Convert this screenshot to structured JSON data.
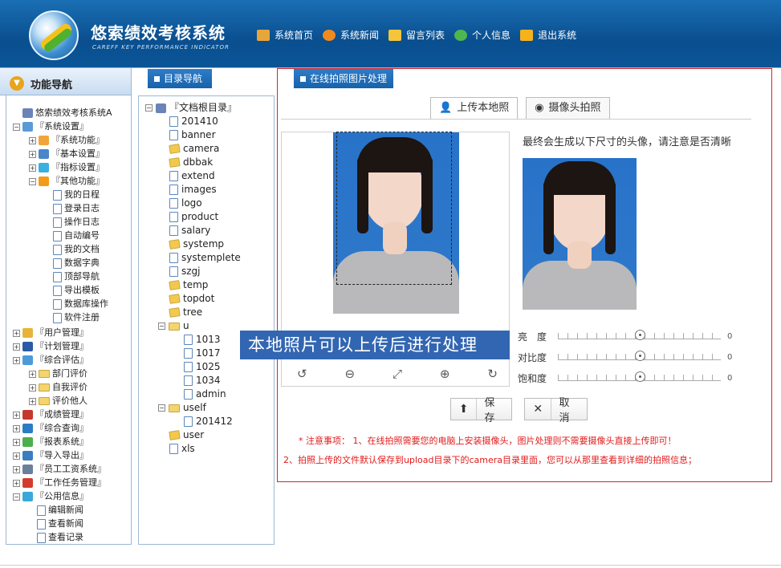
{
  "header": {
    "title": "悠索绩效考核系统",
    "subtitle": "CAREFF KEY PERFORMANCE INDICATOR",
    "nav": [
      {
        "label": "系统首页",
        "icon": "home-icon",
        "color": "#e6a63a"
      },
      {
        "label": "系统新闻",
        "icon": "news-icon",
        "color": "#f08a1e"
      },
      {
        "label": "留言列表",
        "icon": "message-icon",
        "color": "#f4c53b"
      },
      {
        "label": "个人信息",
        "icon": "user-info-icon",
        "color": "#4fb54f"
      },
      {
        "label": "退出系统",
        "icon": "logout-icon",
        "color": "#f5b21d"
      }
    ]
  },
  "left_nav": {
    "title": "功能导航",
    "items": [
      {
        "label": "悠索绩效考核系统A"
      },
      {
        "label": "『系统设置』"
      },
      {
        "label": "『系统功能』"
      },
      {
        "label": "『基本设置』"
      },
      {
        "label": "『指标设置』"
      },
      {
        "label": "『其他功能』"
      },
      {
        "label": "我的日程"
      },
      {
        "label": "登录日志"
      },
      {
        "label": "操作日志"
      },
      {
        "label": "自动编号"
      },
      {
        "label": "我的文档"
      },
      {
        "label": "数据字典"
      },
      {
        "label": "顶部导航"
      },
      {
        "label": "导出模板"
      },
      {
        "label": "数据库操作"
      },
      {
        "label": "软件注册"
      },
      {
        "label": "『用户管理』"
      },
      {
        "label": "『计划管理』"
      },
      {
        "label": "『综合评估』"
      },
      {
        "label": "部门评价"
      },
      {
        "label": "自我评价"
      },
      {
        "label": "评价他人"
      },
      {
        "label": "『成绩管理』"
      },
      {
        "label": "『综合查询』"
      },
      {
        "label": "『报表系统』"
      },
      {
        "label": "『导入导出』"
      },
      {
        "label": "『员工工资系统』"
      },
      {
        "label": "『工作任务管理』"
      },
      {
        "label": "『公用信息』"
      },
      {
        "label": "编辑新闻"
      },
      {
        "label": "查看新闻"
      },
      {
        "label": "查看记录"
      }
    ]
  },
  "dir_tab": {
    "label": "目录导航"
  },
  "dir_tree": {
    "root": "『文档根目录』",
    "items": [
      "201410",
      "banner",
      "camera",
      "dbbak",
      "extend",
      "images",
      "logo",
      "product",
      "salary",
      "systemp",
      "systemplete",
      "szgj",
      "temp",
      "topdot",
      "tree",
      "u",
      "1013",
      "1017",
      "1025",
      "1034",
      "admin",
      "uself",
      "201412",
      "user",
      "xls"
    ]
  },
  "main": {
    "tab_label": "在线拍照图片处理",
    "tabs": [
      "上传本地照",
      "摄像头拍照"
    ],
    "preview_text": "最终会生成以下尺寸的头像，请注意是否清晰",
    "sliders": [
      {
        "label": "亮　度",
        "value": "0"
      },
      {
        "label": "对比度",
        "value": "0"
      },
      {
        "label": "饱和度",
        "value": "0"
      }
    ],
    "overlay_text": "本地照片可以上传后进行处理",
    "save_label": "保存",
    "cancel_label": "取消",
    "note1": "* 注意事项： 1、在线拍照需要您的电脑上安装摄像头，图片处理则不需要摄像头直接上传即可！",
    "note2": "2、拍照上传的文件默认保存到upload目录下的camera目录里面，您可以从那里查看到详细的拍照信息；"
  }
}
